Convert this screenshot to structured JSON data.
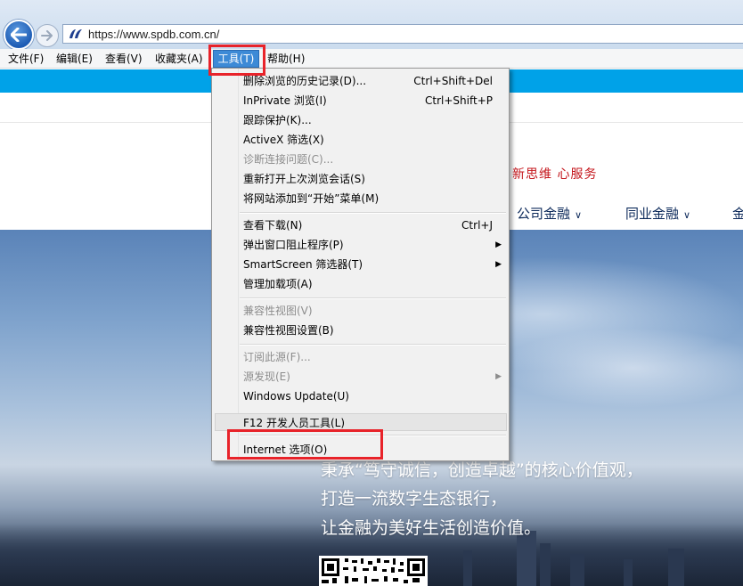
{
  "browser": {
    "url": "https://www.spdb.com.cn/"
  },
  "menubar": {
    "file": "文件(F)",
    "edit": "编辑(E)",
    "view": "查看(V)",
    "favorites": "收藏夹(A)",
    "tools": "工具(T)",
    "help": "帮助(H)"
  },
  "tools_menu": {
    "items": [
      {
        "label": "删除浏览的历史记录(D)...",
        "shortcut": "Ctrl+Shift+Del",
        "enabled": true
      },
      {
        "label": "InPrivate 浏览(I)",
        "shortcut": "Ctrl+Shift+P",
        "enabled": true
      },
      {
        "label": "跟踪保护(K)...",
        "shortcut": "",
        "enabled": true
      },
      {
        "label": "ActiveX 筛选(X)",
        "shortcut": "",
        "enabled": true
      },
      {
        "label": "诊断连接问题(C)...",
        "shortcut": "",
        "enabled": false
      },
      {
        "label": "重新打开上次浏览会话(S)",
        "shortcut": "",
        "enabled": true
      },
      {
        "label": "将网站添加到“开始”菜单(M)",
        "shortcut": "",
        "enabled": true
      },
      {
        "label": "查看下载(N)",
        "shortcut": "Ctrl+J",
        "enabled": true
      },
      {
        "label": "弹出窗口阻止程序(P)",
        "shortcut": "",
        "enabled": true,
        "submenu": true
      },
      {
        "label": "SmartScreen 筛选器(T)",
        "shortcut": "",
        "enabled": true,
        "submenu": true
      },
      {
        "label": "管理加载项(A)",
        "shortcut": "",
        "enabled": true
      },
      {
        "label": "兼容性视图(V)",
        "shortcut": "",
        "enabled": false
      },
      {
        "label": "兼容性视图设置(B)",
        "shortcut": "",
        "enabled": true
      },
      {
        "label": "订阅此源(F)...",
        "shortcut": "",
        "enabled": false
      },
      {
        "label": "源发现(E)",
        "shortcut": "",
        "enabled": false,
        "submenu": true
      },
      {
        "label": "Windows Update(U)",
        "shortcut": "",
        "enabled": true
      },
      {
        "label": "F12 开发人员工具(L)",
        "shortcut": "",
        "enabled": true
      },
      {
        "label": "Internet 选项(O)",
        "shortcut": "",
        "enabled": true
      }
    ],
    "submenu_arrow": "▶"
  },
  "page": {
    "slogan": "新思维  心服务",
    "nav": [
      {
        "label": "公司金融"
      },
      {
        "label": "同业金融"
      },
      {
        "label": "金"
      }
    ],
    "nav_chevron": "∨",
    "hero_lines": [
      "秉承“笃守诚信，创造卓越”的核心价值观，",
      "打造一流数字生态银行，",
      "让金融为美好生活创造价值。"
    ]
  },
  "colors": {
    "accent_strip": "#00a2e8",
    "highlight_box": "#e8232a",
    "menu_selected": "#3d8ad6",
    "slogan": "#c4151b"
  },
  "icons": {
    "back": "back-arrow-icon",
    "forward": "forward-arrow-icon",
    "site": "spdb-logo-icon",
    "qr": "qr-code-icon"
  }
}
